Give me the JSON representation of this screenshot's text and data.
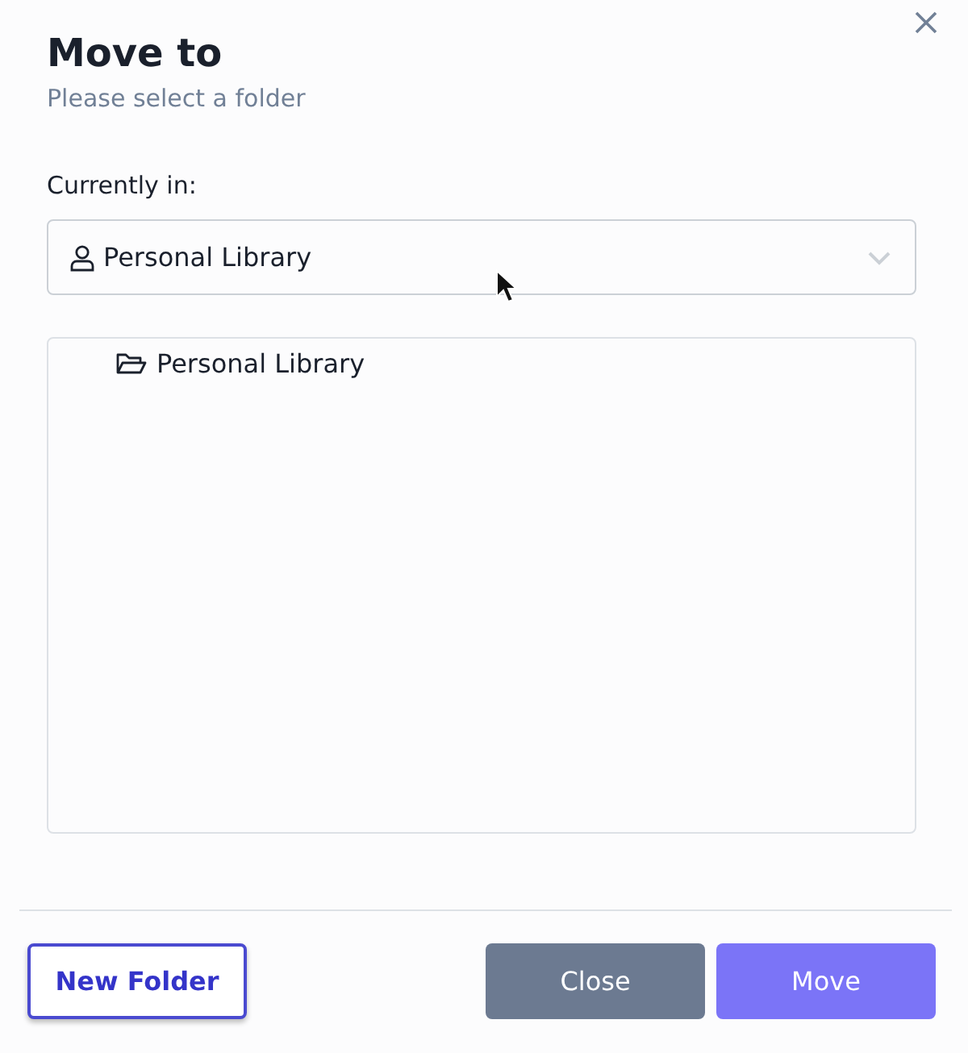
{
  "dialog": {
    "title": "Move to",
    "subtitle": "Please select a folder"
  },
  "location": {
    "label": "Currently in:",
    "value": "Personal Library"
  },
  "tree": {
    "items": [
      {
        "label": "Personal Library",
        "selected": false
      }
    ]
  },
  "buttons": [
    {
      "label": "New Folder",
      "kind": "outline"
    },
    {
      "label": "Close",
      "kind": "secondary"
    },
    {
      "label": "Move",
      "kind": "primary"
    }
  ]
}
